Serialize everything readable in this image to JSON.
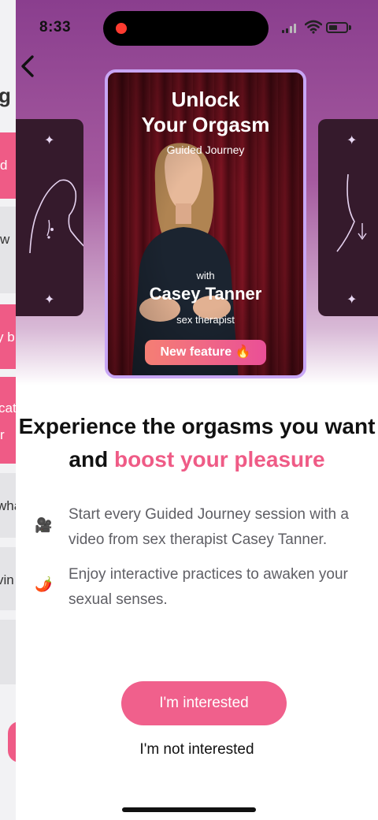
{
  "status_bar": {
    "time": "8:33"
  },
  "background_page": {
    "header_fragment": "g",
    "fragments": [
      "d",
      "w",
      "y b",
      "cat",
      "r",
      "wha",
      "vin"
    ]
  },
  "card": {
    "title_line1": "Unlock",
    "title_line2": "Your Orgasm",
    "subtitle": "Guided Journey",
    "with": "with",
    "host": "Casey Tanner",
    "host_role": "sex therapist",
    "badge": "New feature 🔥"
  },
  "headline": {
    "part1": "Experience the orgasms you want and ",
    "accent": "boost your pleasure"
  },
  "features": [
    {
      "icon": "🎥",
      "text": "Start every Guided Journey session with a video from sex therapist Casey Tanner."
    },
    {
      "icon": "🌶️",
      "text": "Enjoy interactive practices to awaken your sexual senses."
    }
  ],
  "buttons": {
    "primary": "I'm interested",
    "secondary": "I'm not interested"
  },
  "colors": {
    "accent": "#ef5b86",
    "button": "#f0608c",
    "card_border": "#c8a6f5",
    "side_card": "#351a2c"
  }
}
